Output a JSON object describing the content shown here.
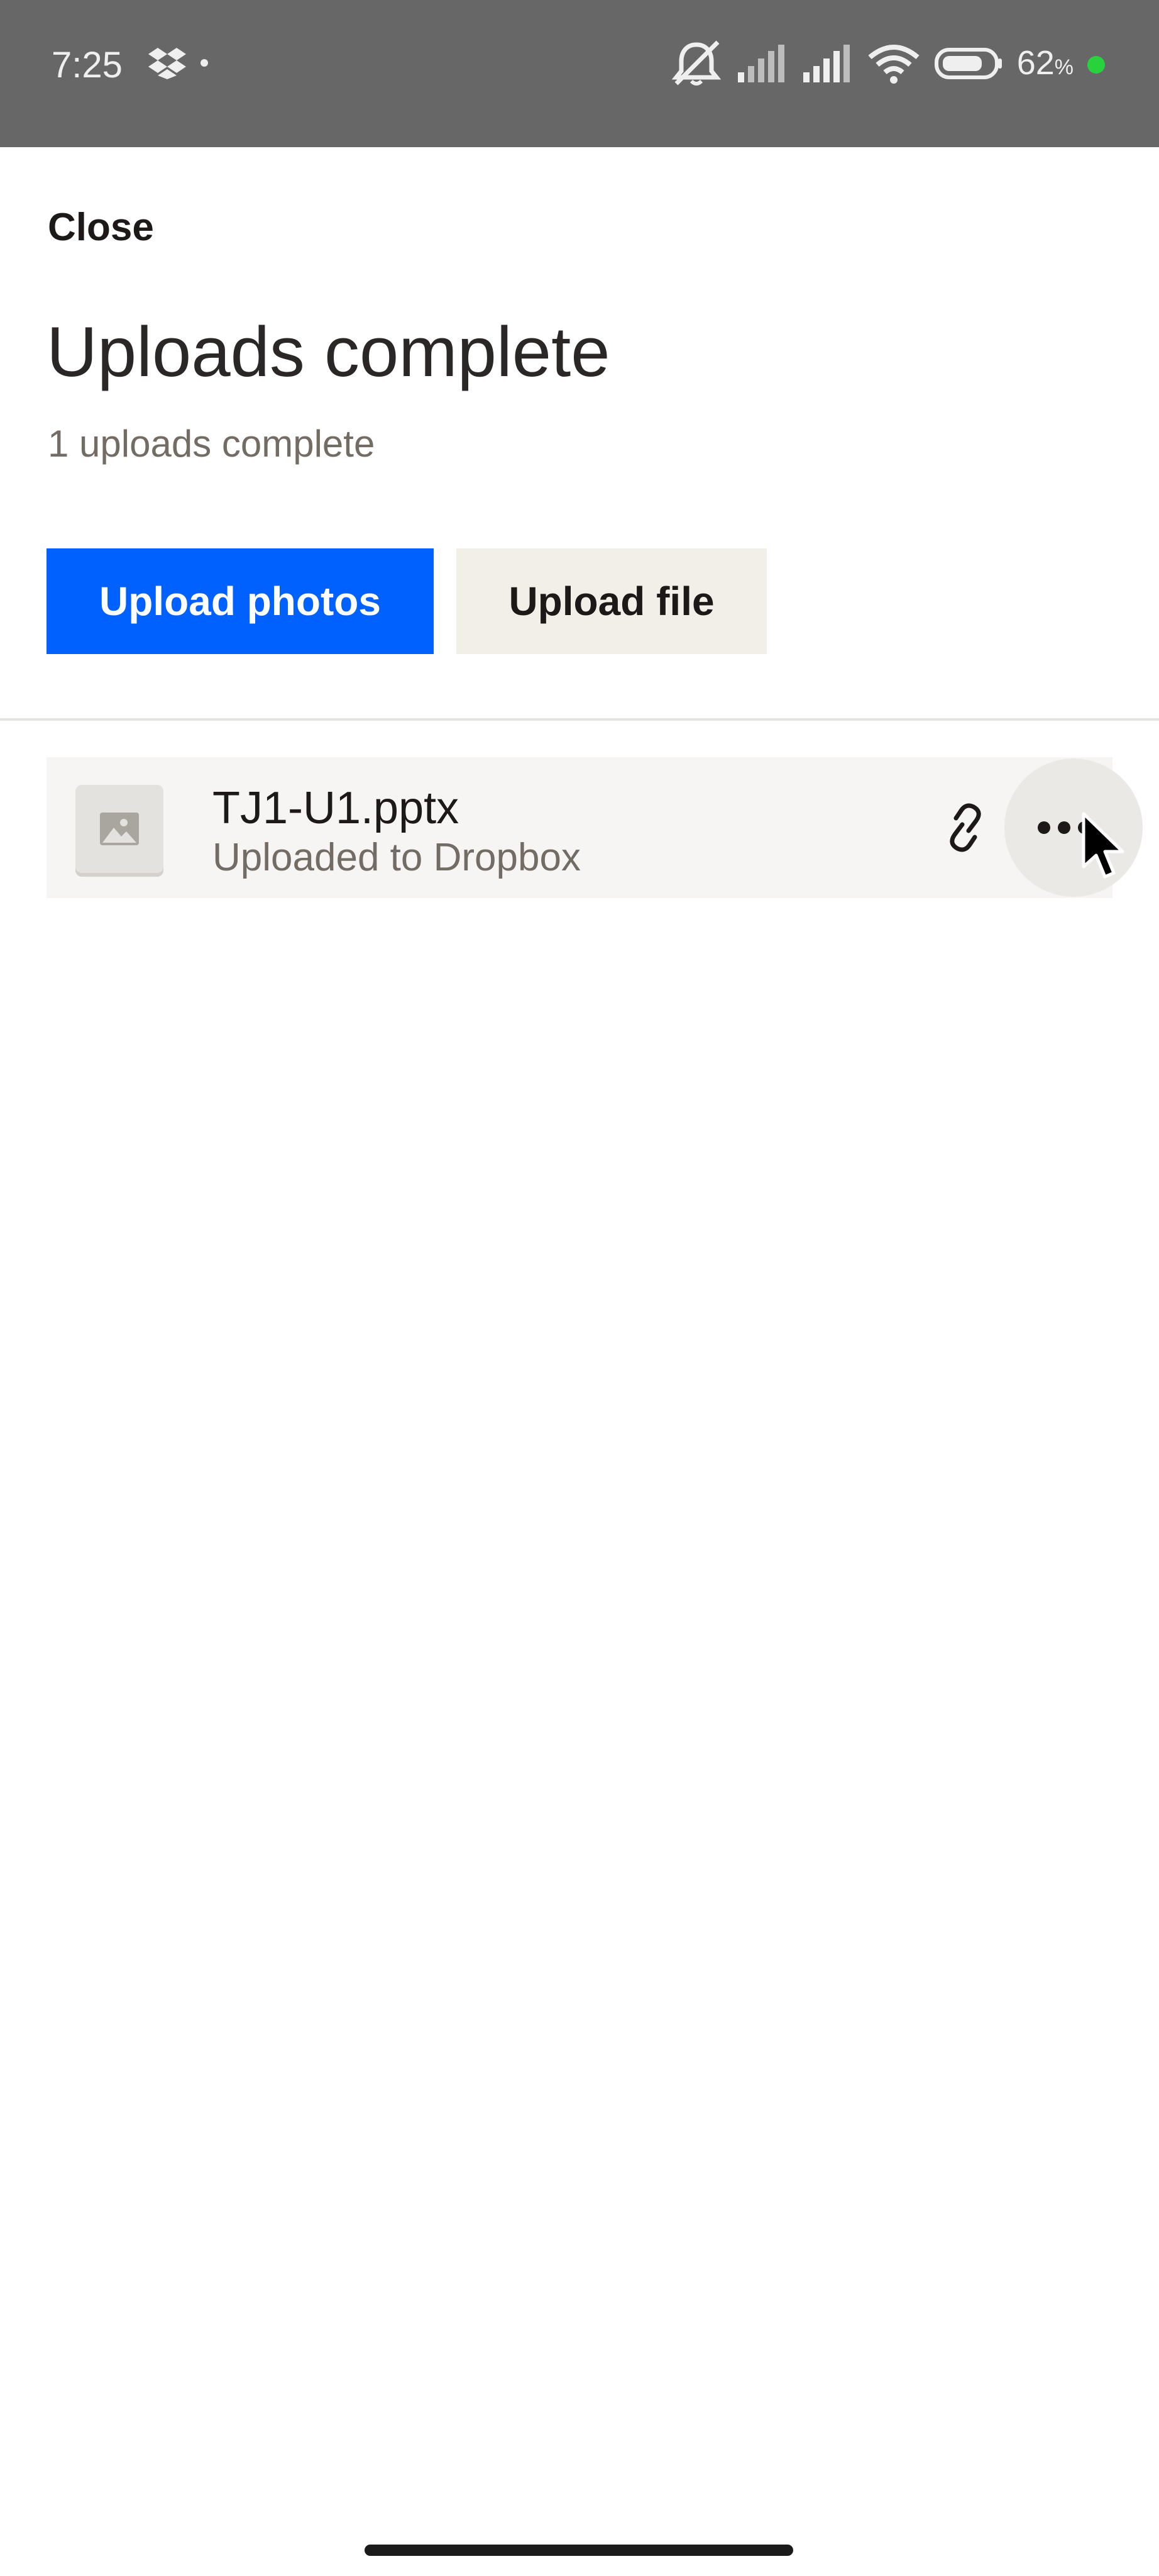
{
  "status_bar": {
    "time": "7:25",
    "left_icons": [
      "dropbox-icon",
      "dot-icon"
    ],
    "right_icons": [
      "mute-alarm-icon",
      "signal-icon",
      "signal-icon",
      "wifi-icon",
      "battery-icon"
    ],
    "battery_percent": "62",
    "battery_percent_sign": "%",
    "charge_indicator_color": "#27d23c"
  },
  "header": {
    "close_label": "Close",
    "title": "Uploads complete",
    "subtitle": "1 uploads complete"
  },
  "actions": {
    "upload_photos_label": "Upload photos",
    "upload_file_label": "Upload file",
    "primary_color": "#0061fe"
  },
  "files": [
    {
      "name": "TJ1-U1.pptx",
      "status": "Uploaded to Dropbox",
      "thumbnail_icon": "image-icon",
      "actions": [
        "link-icon",
        "more-icon"
      ]
    }
  ]
}
